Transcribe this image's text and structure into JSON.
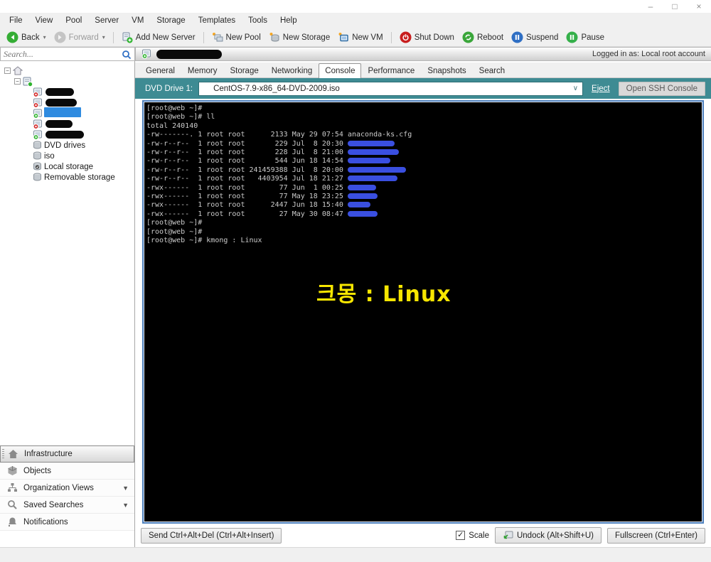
{
  "window": {
    "minimize": "–",
    "maximize": "□",
    "close": "×"
  },
  "menu": {
    "items": [
      "File",
      "View",
      "Pool",
      "Server",
      "VM",
      "Storage",
      "Templates",
      "Tools",
      "Help"
    ]
  },
  "toolbar": {
    "back_label": "Back",
    "forward_label": "Forward",
    "add_new_server_label": "Add New Server",
    "new_pool_label": "New Pool",
    "new_storage_label": "New Storage",
    "new_vm_label": "New VM",
    "shut_down_label": "Shut Down",
    "reboot_label": "Reboot",
    "suspend_label": "Suspend",
    "pause_label": "Pause"
  },
  "search": {
    "placeholder": "Search..."
  },
  "header": {
    "logged_in": "Logged in as: Local root account"
  },
  "tree": {
    "storage_items": [
      {
        "label": "DVD drives"
      },
      {
        "label": "iso"
      },
      {
        "label": "Local storage"
      },
      {
        "label": "Removable storage"
      }
    ]
  },
  "tabs": {
    "items": [
      "General",
      "Memory",
      "Storage",
      "Networking",
      "Console",
      "Performance",
      "Snapshots",
      "Search"
    ],
    "active": "Console"
  },
  "dvd_bar": {
    "label": "DVD Drive 1:",
    "selected_iso": "CentOS-7.9-x86_64-DVD-2009.iso",
    "eject_label": "Eject",
    "ssh_button_label": "Open SSH Console"
  },
  "console": {
    "lines": [
      "[root@web ~]#",
      "[root@web ~]# ll",
      "total 240140",
      "-rw-------. 1 root root      2133 May 29 07:54 anaconda-ks.cfg",
      "-rw-r--r--  1 root root       229 Jul  8 20:30 ",
      "-rw-r--r--  1 root root       228 Jul  8 21:00 ",
      "-rw-r--r--  1 root root       544 Jun 18 14:54 ",
      "-rw-r--r--  1 root root 241459388 Jul  8 20:00 ",
      "-rw-r--r--  1 root root   4403954 Jul 18 21:27 ",
      "-rwx------  1 root root        77 Jun  1 00:25 ",
      "-rwx------  1 root root        77 May 18 23:25 ",
      "-rwx------  1 root root      2447 Jun 18 15:40 ",
      "-rwx------  1 root root        27 May 30 08:47 ",
      "[root@web ~]#",
      "[root@web ~]#",
      "[root@web ~]# kmong : Linux"
    ],
    "overlay_text": "크몽 : Linux"
  },
  "console_controls": {
    "send_cad_label": "Send Ctrl+Alt+Del (Ctrl+Alt+Insert)",
    "scale_label": "Scale",
    "scale_checked": true,
    "undock_label": "Undock (Alt+Shift+U)",
    "fullscreen_label": "Fullscreen (Ctrl+Enter)"
  },
  "nav": {
    "items": [
      {
        "label": "Infrastructure"
      },
      {
        "label": "Objects"
      },
      {
        "label": "Organization Views"
      },
      {
        "label": "Saved Searches"
      },
      {
        "label": "Notifications"
      }
    ]
  },
  "colors": {
    "teal_bar": "#3e8b93",
    "console_border": "#4f81bd",
    "overlay_yellow": "#f7e600",
    "redaction_blue": "#3a4fe0",
    "selection_blue": "#2f8be0"
  }
}
